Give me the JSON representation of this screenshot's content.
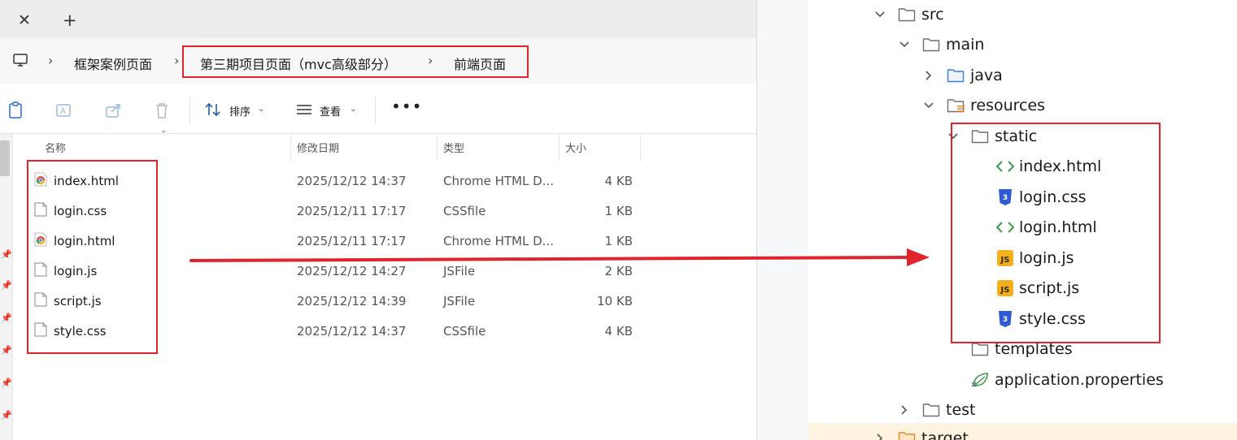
{
  "explorer": {
    "tab_close": "✕",
    "tab_add": "+",
    "breadcrumb": [
      "框架案例页面",
      "第三期项目页面（mvc高级部分）",
      "前端页面"
    ],
    "toolbar": {
      "sort_label": "排序",
      "view_label": "查看",
      "more_label": "•••"
    },
    "columns": {
      "name": "名称",
      "modified": "修改日期",
      "type": "类型",
      "size": "大小"
    },
    "files": [
      {
        "name": "index.html",
        "modified": "2025/12/12 14:37",
        "type": "Chrome HTML D...",
        "size": "4 KB",
        "icon": "chrome-icon"
      },
      {
        "name": "login.css",
        "modified": "2025/12/11 17:17",
        "type": "CSSfile",
        "size": "1 KB",
        "icon": "file-icon"
      },
      {
        "name": "login.html",
        "modified": "2025/12/11 17:17",
        "type": "Chrome HTML D...",
        "size": "1 KB",
        "icon": "chrome-icon"
      },
      {
        "name": "login.js",
        "modified": "2025/12/12 14:27",
        "type": "JSFile",
        "size": "2 KB",
        "icon": "file-icon"
      },
      {
        "name": "script.js",
        "modified": "2025/12/12 14:39",
        "type": "JSFile",
        "size": "10 KB",
        "icon": "file-icon"
      },
      {
        "name": "style.css",
        "modified": "2025/12/12 14:37",
        "type": "CSSfile",
        "size": "4 KB",
        "icon": "file-icon"
      }
    ]
  },
  "project_tree": {
    "nodes": [
      {
        "label": "src",
        "icon": "folder-icon",
        "state": "expanded"
      },
      {
        "label": "main",
        "icon": "folder-icon",
        "state": "expanded"
      },
      {
        "label": "java",
        "icon": "source-folder-icon",
        "state": "collapsed"
      },
      {
        "label": "resources",
        "icon": "resources-folder-icon",
        "state": "expanded"
      },
      {
        "label": "static",
        "icon": "folder-icon",
        "state": "expanded"
      },
      {
        "label": "index.html",
        "icon": "html-icon"
      },
      {
        "label": "login.css",
        "icon": "css-icon"
      },
      {
        "label": "login.html",
        "icon": "html-icon"
      },
      {
        "label": "login.js",
        "icon": "js-icon"
      },
      {
        "label": "script.js",
        "icon": "js-icon"
      },
      {
        "label": "style.css",
        "icon": "css-icon"
      },
      {
        "label": "templates",
        "icon": "folder-icon"
      },
      {
        "label": "application.properties",
        "icon": "spring-properties-icon"
      },
      {
        "label": "test",
        "icon": "folder-icon",
        "state": "collapsed"
      },
      {
        "label": "target",
        "icon": "excluded-folder-icon",
        "state": "collapsed"
      }
    ]
  },
  "colors": {
    "highlight_box": "#e0242b",
    "arrow": "#e0242b",
    "css_icon": "#2f5bd6",
    "js_icon": "#f2b01e",
    "html_icon": "#3a9a4a"
  }
}
